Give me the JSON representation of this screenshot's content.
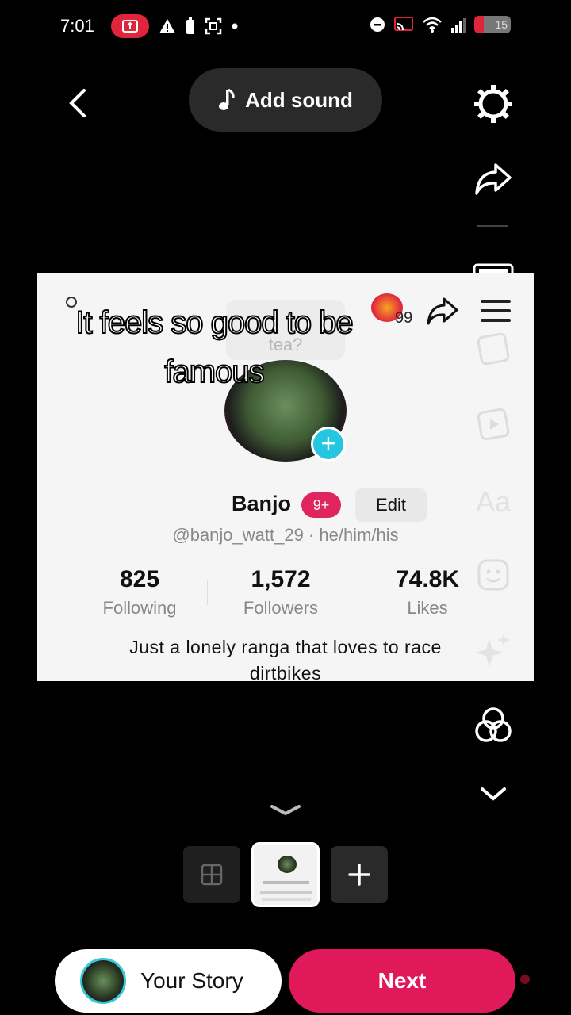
{
  "status_bar": {
    "time": "7:01",
    "battery_level": "15",
    "colors": {
      "record_pill": "#e0243c"
    }
  },
  "top_bar": {
    "add_sound_label": "Add sound"
  },
  "overlay_caption": {
    "line1": "It feels so good to be",
    "line2": "famous"
  },
  "profile": {
    "note_bubble": "tea?",
    "streak_count": "99",
    "name": "Banjo",
    "badge": "9+",
    "edit_label": "Edit",
    "handle": "@banjo_watt_29 · he/him/his",
    "stats": [
      {
        "value": "825",
        "label": "Following"
      },
      {
        "value": "1,572",
        "label": "Followers"
      },
      {
        "value": "74.8K",
        "label": "Likes"
      }
    ],
    "bio_line1": "Just a lonely ranga that loves to race",
    "bio_line2": "dirtbikes"
  },
  "right_rail": {
    "icons": [
      "settings-icon",
      "share-icon",
      "crop-icon",
      "sticker-icon",
      "clip-icon",
      "text-icon",
      "emoji-sticker-icon",
      "effects-icon",
      "filters-icon",
      "chevron-down-icon"
    ]
  },
  "footer": {
    "your_story_label": "Your Story",
    "next_label": "Next",
    "colors": {
      "next": "#e0195a",
      "story_ring": "#38c7d8"
    }
  }
}
